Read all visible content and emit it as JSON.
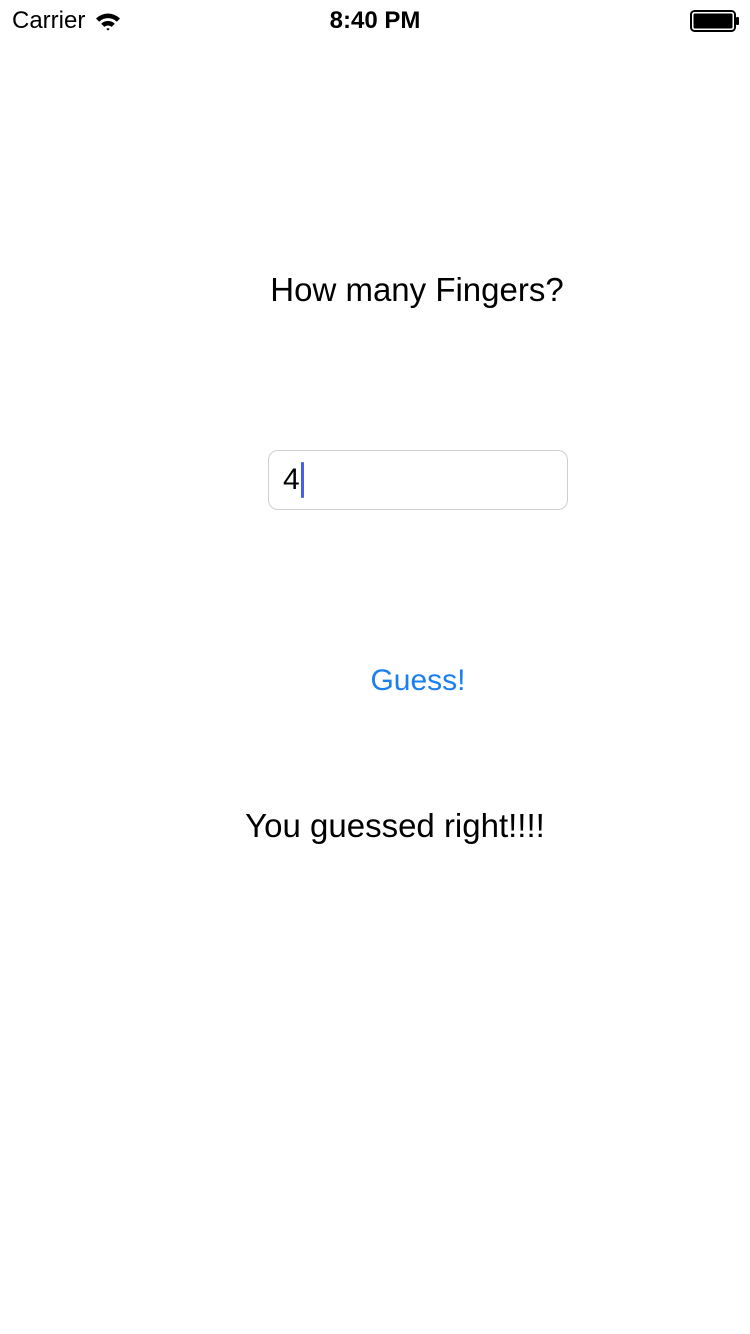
{
  "status_bar": {
    "carrier": "Carrier",
    "time": "8:40 PM",
    "wifi_icon": "wifi-icon",
    "battery_icon": "battery-full-icon"
  },
  "main": {
    "prompt": "How many Fingers?",
    "guess_input": {
      "value": "4"
    },
    "guess_button_label": "Guess!",
    "result_text": "You guessed right!!!!"
  },
  "colors": {
    "accent": "#1a7ff0",
    "caret": "#4a5fe8",
    "input_border": "#cfcfcf",
    "text": "#000000",
    "background": "#ffffff"
  }
}
